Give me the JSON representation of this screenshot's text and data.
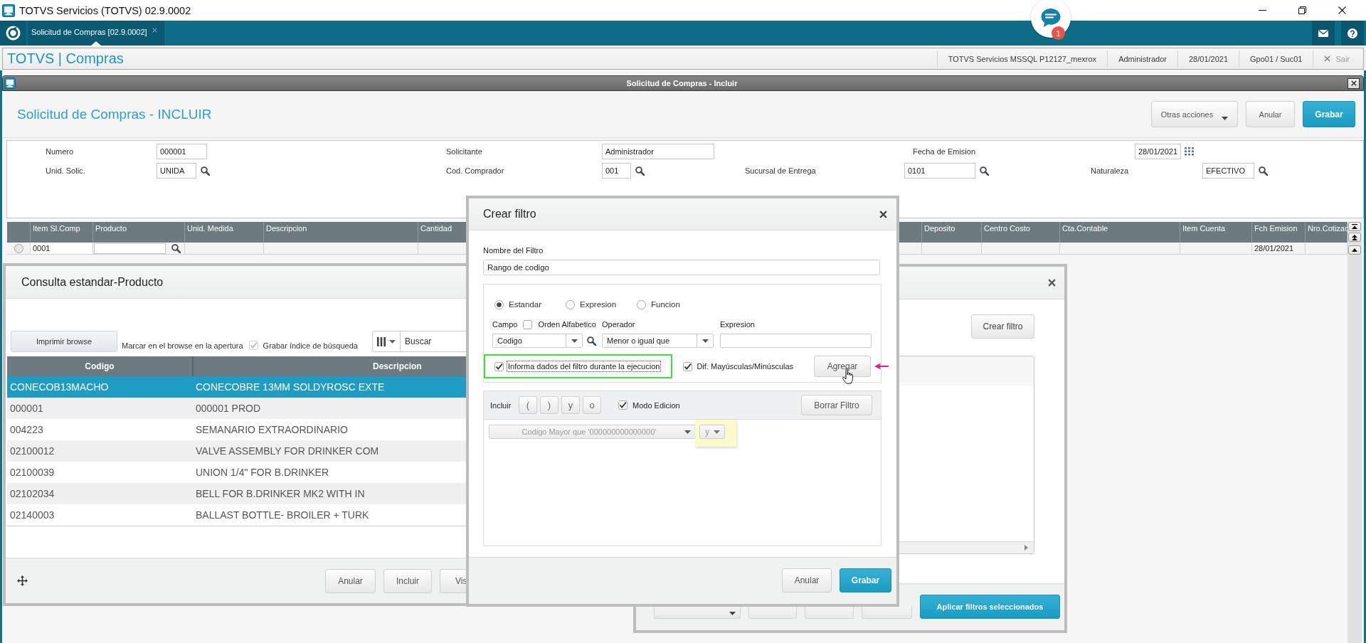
{
  "window": {
    "title": "TOTVS Servicios (TOTVS) 02.9.0002"
  },
  "tabs": [
    {
      "label": "Solicitud de Compras [02.9.0002]",
      "selected": true
    }
  ],
  "notifications": {
    "count": "1"
  },
  "header": {
    "brand": "TOTVS | Compras",
    "info": [
      "TOTVS Servicios MSSQL P12127_mexrox",
      "Administrador",
      "28/01/2021",
      "Gpo01 / Suc01"
    ],
    "exit": "Sair"
  },
  "form": {
    "window_title": "Solicitud de Compras - Incluir",
    "title": "Solicitud de Compras - INCLUIR",
    "buttons": [
      {
        "label": "Otras acciones",
        "kind": "dropdown"
      },
      {
        "label": "Anular",
        "kind": "default"
      },
      {
        "label": "Grabar",
        "kind": "primary"
      }
    ],
    "fields": [
      [
        {
          "label": "Numero",
          "value": "000001",
          "kind": "text"
        },
        {
          "label": "Solicitante",
          "value": "Administrador",
          "kind": "text"
        },
        {
          "label": "Fecha de Emision",
          "value": "28/01/2021",
          "kind": "date"
        }
      ],
      [
        {
          "label": "Unid. Solic.",
          "value": "UNIDA",
          "kind": "lookup"
        },
        {
          "label": "Cod. Comprador",
          "value": "001",
          "kind": "lookup"
        },
        {
          "label": "Sucursal de Entrega",
          "value": "0101",
          "kind": "lookup"
        },
        {
          "label": "Naturaleza",
          "value": "EFECTIVO",
          "kind": "lookup"
        }
      ]
    ]
  },
  "items_grid": {
    "columns": [
      "Item Sl.Comp",
      "Producto",
      "Unid. Medida",
      "Descripcion",
      "Cantidad",
      "Deposito",
      "Centro Costo",
      "Cta.Contable",
      "Item Cuenta",
      "Fch Emision",
      "Nro.Cotizac"
    ],
    "rows": [
      {
        "selected": false,
        "cells": [
          {
            "kind": "text",
            "value": "0001"
          },
          {
            "kind": "lookup"
          },
          {
            "kind": "text"
          },
          {
            "kind": "text"
          },
          {
            "kind": "text"
          },
          {
            "kind": "text"
          },
          {
            "kind": "text"
          },
          {
            "kind": "text"
          },
          {
            "kind": "text"
          },
          {
            "kind": "text",
            "value": "28/01/2021"
          },
          {
            "kind": "text"
          }
        ]
      }
    ]
  },
  "lookup": {
    "title": "Consulta estandar-Producto",
    "print_button": "Imprimir browse",
    "mark_label": "Marcar en el browse en la apertura",
    "save_index": {
      "label": "Grabar índice de búsqueda",
      "checked": true,
      "disabled": true
    },
    "search": {
      "placeholder": "Buscar"
    },
    "columns": [
      "Codigo",
      "Descripcion"
    ],
    "rows": [
      {
        "code": "CONECOB13MACHO",
        "description": "CONECOBRE 13MM SOLDYROSC EXTE",
        "selected": true
      },
      {
        "code": "000001",
        "description": "000001 PROD",
        "selected": false
      },
      {
        "code": "004223",
        "description": "SEMANARIO EXTRAORDINARIO",
        "selected": false
      },
      {
        "code": "02100012",
        "description": "VALVE ASSEMBLY FOR DRINKER COM",
        "selected": false
      },
      {
        "code": "02100039",
        "description": "UNION 1/4\" FOR B.DRINKER",
        "selected": false
      },
      {
        "code": "02102034",
        "description": "BELL FOR B.DRINKER MK2 WITH IN",
        "selected": false
      },
      {
        "code": "02140003",
        "description": "BALLAST BOTTLE- BROILER + TURK",
        "selected": false
      }
    ],
    "buttons": [
      "Anular",
      "Incluir",
      "Vis"
    ]
  },
  "filter_manager": {
    "create_button": "Crear filtro",
    "covered_buttons": [
      {
        "kind": "dropdown"
      },
      {
        "kind": "plain"
      },
      {
        "kind": "plain"
      },
      {
        "kind": "plain"
      }
    ],
    "apply_button": "Aplicar filtros seleccionados"
  },
  "filter_dialog": {
    "title": "Crear filtro",
    "name": {
      "label": "Nombre del Filtro",
      "value": "Rango de codigo"
    },
    "modes": [
      {
        "label": "Estandar",
        "selected": true
      },
      {
        "label": "Expresion",
        "selected": false
      },
      {
        "label": "Funcion",
        "selected": false
      }
    ],
    "field": {
      "label": "Campo",
      "value": "Codigo"
    },
    "alphabetical": {
      "label": "Orden Alfabetico",
      "checked": false
    },
    "operator": {
      "label": "Operador",
      "value": "Menor o igual que"
    },
    "expression": {
      "label": "Expresion"
    },
    "options": [
      {
        "label": "Informa dados del filtro durante la ejecucion",
        "checked": true,
        "highlighted": true,
        "focused": true
      },
      {
        "label": "Dif. Mayúsculas/Minúsculas",
        "checked": true,
        "highlighted": false,
        "focused": false
      }
    ],
    "add_button": "Agregar",
    "include": {
      "label": "Incluir",
      "buttons": [
        "(",
        ")",
        "y",
        "o"
      ]
    },
    "edit_mode": {
      "label": "Modo Edicion",
      "checked": true
    },
    "clear_button": "Borrar Filtro",
    "conditions": [
      {
        "text": "Codigo Mayor que '000000000000000'",
        "connector": "y",
        "disabled": true,
        "highlighted": true
      }
    ],
    "buttons": [
      {
        "label": "Anular",
        "kind": "default"
      },
      {
        "label": "Grabar",
        "kind": "primary"
      }
    ]
  }
}
